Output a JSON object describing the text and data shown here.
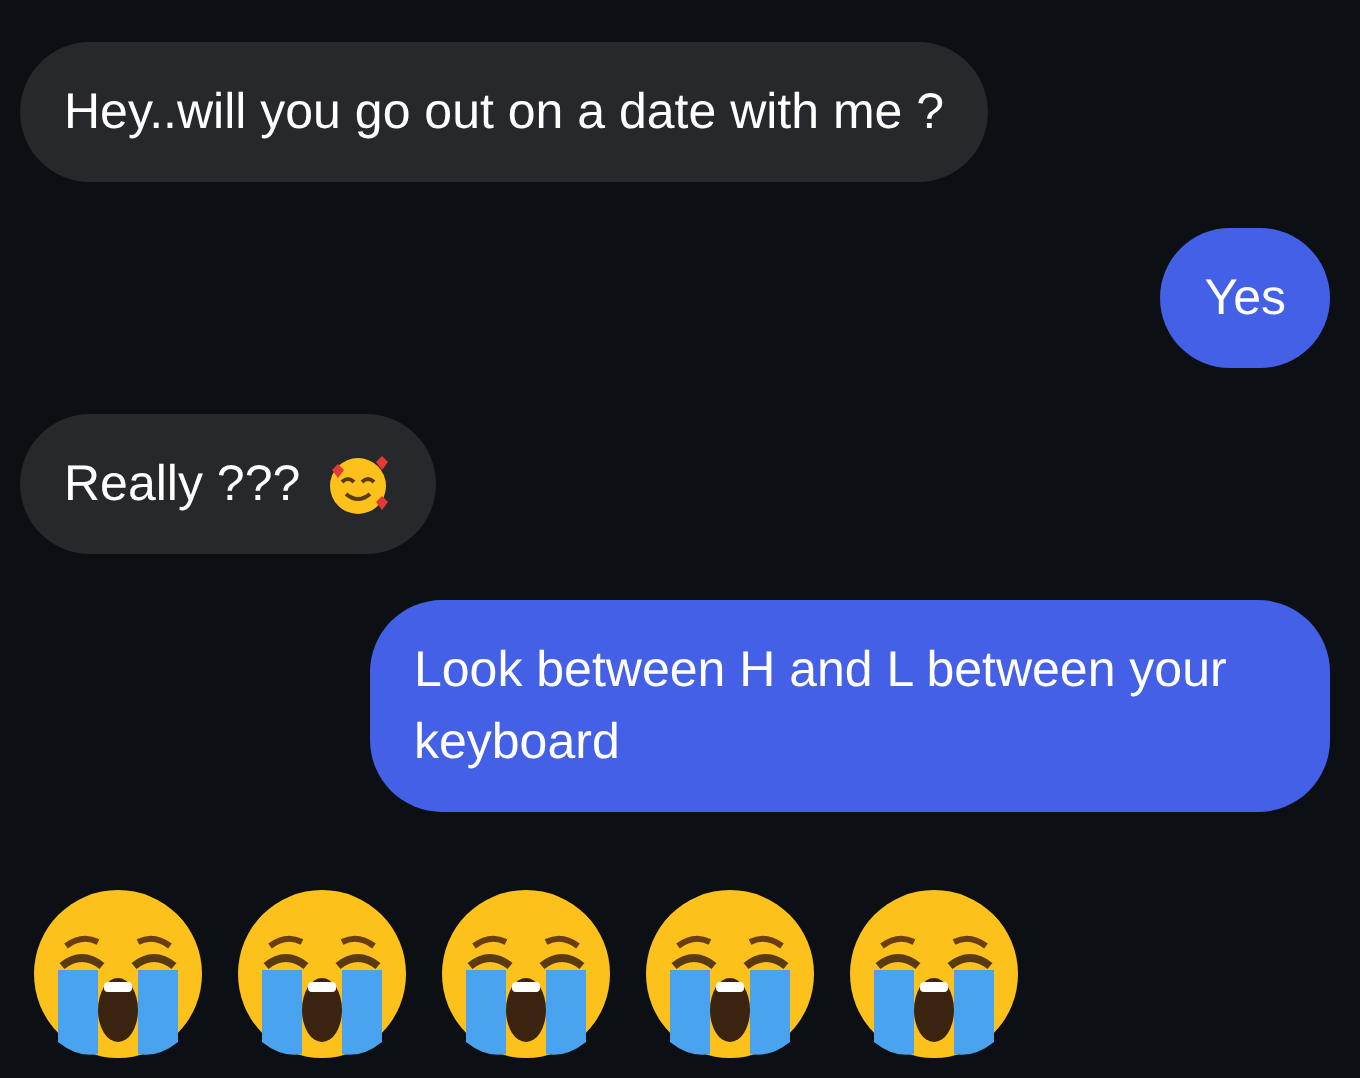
{
  "messages": [
    {
      "kind": "text",
      "outgoing": false,
      "text": "Hey..will you go out on a date with me ?"
    },
    {
      "kind": "text",
      "outgoing": true,
      "text": "Yes"
    },
    {
      "kind": "text_with_emoji",
      "outgoing": false,
      "text": "Really ???"
    },
    {
      "kind": "text",
      "outgoing": true,
      "text": "Look between H and L between your keyboard"
    },
    {
      "kind": "emoji_row",
      "outgoing": false,
      "items": [
        {
          "kind": "crying"
        },
        {
          "kind": "crying"
        },
        {
          "kind": "crying"
        },
        {
          "kind": "crying"
        },
        {
          "kind": "crying"
        }
      ]
    }
  ]
}
